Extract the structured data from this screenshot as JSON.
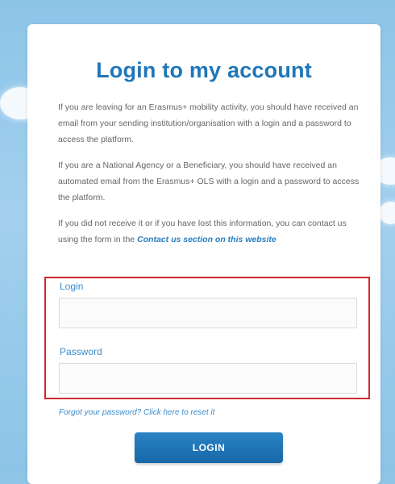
{
  "login_card": {
    "title": "Login to my account",
    "paragraphs": [
      "If you are leaving for an Erasmus+ mobility activity, you should have received an email from your sending institution/organisation with a login and a password to access the platform.",
      "If you are a National Agency or a Beneficiary, you should have received an automated email from the Erasmus+ OLS with a login and a password to access the platform."
    ],
    "contact_prefix": "If you did not receive it or if you have lost this information, you can contact us using the form in the ",
    "contact_link": "Contact us section on this website",
    "login_label": "Login",
    "login_value": "",
    "password_label": "Password",
    "password_value": "",
    "forgot_link": "Forgot your password? Click here to reset it",
    "login_button": "LOGIN"
  },
  "colors": {
    "accent": "#1f77b8",
    "highlight_border": "#d0282e",
    "background": "#8fc6e8"
  }
}
